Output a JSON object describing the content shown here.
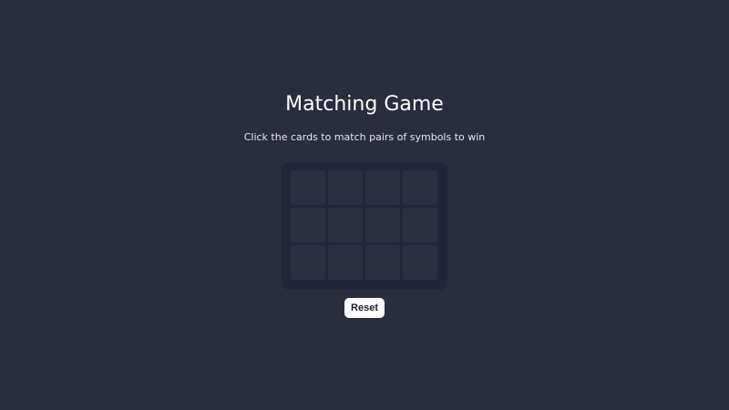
{
  "game": {
    "title": "Matching Game",
    "instructions": "Click the cards to match pairs of symbols to win",
    "grid": {
      "rows": 3,
      "columns": 4,
      "cards": [
        {
          "face_down": true
        },
        {
          "face_down": true
        },
        {
          "face_down": true
        },
        {
          "face_down": true
        },
        {
          "face_down": true
        },
        {
          "face_down": true
        },
        {
          "face_down": true
        },
        {
          "face_down": true
        },
        {
          "face_down": true
        },
        {
          "face_down": true
        },
        {
          "face_down": true
        },
        {
          "face_down": true
        }
      ]
    },
    "reset_label": "Reset"
  },
  "colors": {
    "background": "#292d3e",
    "board": "#23263a",
    "card_back": "#2b2f42",
    "button": "#ffffff",
    "button_text": "#1c1f2b"
  }
}
